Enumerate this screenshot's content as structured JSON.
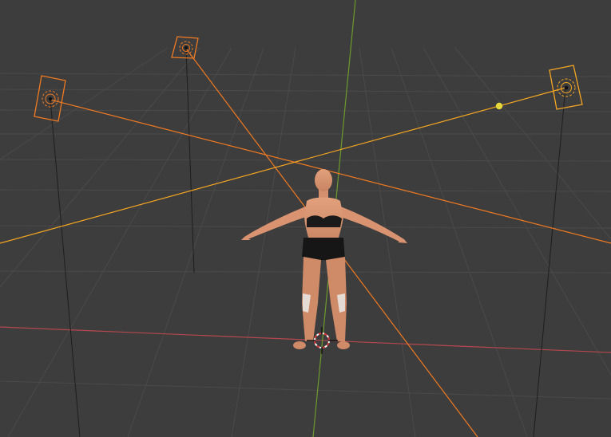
{
  "viewport": {
    "background": "#3d3d3d",
    "grid_color": "#4a4a4a",
    "axis_x_color": "#b5484f",
    "axis_y_color": "#6d9a2c"
  },
  "scene": {
    "selection_color": "#f07a22",
    "active_selection_color": "#f5a623",
    "light_lines_color": "#1e1e1e",
    "target_point_color": "#e6d83a",
    "objects": [
      {
        "name": "area-light-left",
        "type": "area-light",
        "selected": true
      },
      {
        "name": "area-light-center",
        "type": "area-light",
        "selected": true
      },
      {
        "name": "area-light-right",
        "type": "area-light",
        "selected": true,
        "active": true
      },
      {
        "name": "human-figure",
        "type": "mesh",
        "selected": false
      },
      {
        "name": "3d-cursor",
        "type": "cursor",
        "selected": false
      }
    ]
  }
}
